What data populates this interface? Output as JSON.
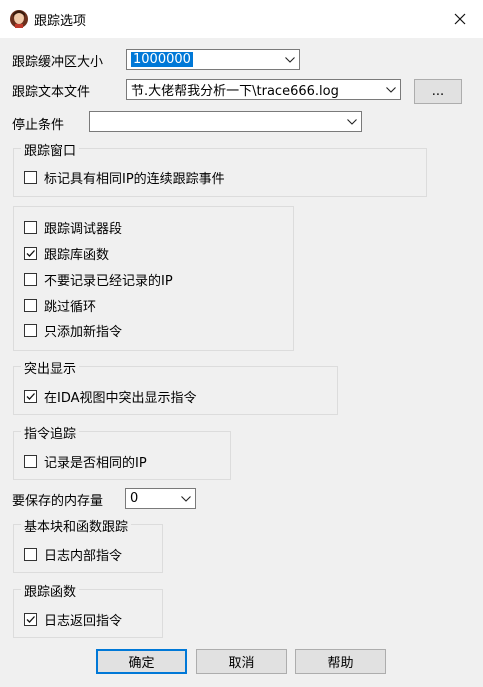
{
  "window": {
    "title": "跟踪选项"
  },
  "fields": {
    "buffer_label": "跟踪缓冲区大小",
    "buffer_value": "1000000",
    "file_label": "跟踪文本文件",
    "file_value": "节.大佬帮我分析一下\\trace666.log",
    "browse_label": "...",
    "stop_label": "停止条件",
    "stop_value": "",
    "memory_label": "要保存的内存量",
    "memory_value": "0"
  },
  "groups": {
    "trace_window": {
      "title": "跟踪窗口",
      "items": [
        {
          "label": "标记具有相同IP的连续跟踪事件",
          "checked": false
        }
      ]
    },
    "options": {
      "items": [
        {
          "label": "跟踪调试器段",
          "checked": false
        },
        {
          "label": "跟踪库函数",
          "checked": true
        },
        {
          "label": "不要记录已经记录的IP",
          "checked": false
        },
        {
          "label": "跳过循环",
          "checked": false
        },
        {
          "label": "只添加新指令",
          "checked": false
        }
      ]
    },
    "highlight": {
      "title": "突出显示",
      "items": [
        {
          "label": "在IDA视图中突出显示指令",
          "checked": true
        }
      ]
    },
    "instr_trace": {
      "title": "指令追踪",
      "items": [
        {
          "label": "记录是否相同的IP",
          "checked": false
        }
      ]
    },
    "block_func": {
      "title": "基本块和函数跟踪",
      "items": [
        {
          "label": "日志内部指令",
          "checked": false
        }
      ]
    },
    "func_trace": {
      "title": "跟踪函数",
      "items": [
        {
          "label": "日志返回指令",
          "checked": true
        }
      ]
    }
  },
  "buttons": {
    "ok": "确定",
    "cancel": "取消",
    "help": "帮助"
  },
  "icons": {
    "app": "ida-avatar-icon",
    "close": "close-icon",
    "dropdown": "chevron-down-icon",
    "check": "checkmark-icon"
  }
}
